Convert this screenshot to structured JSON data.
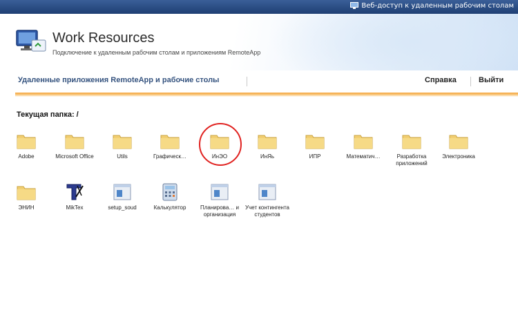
{
  "topbar": {
    "label": "Веб-доступ к удаленным рабочим столам"
  },
  "header": {
    "title": "Work Resources",
    "subtitle": "Подключение к удаленным рабочим столам и приложениям RemoteApp"
  },
  "nav": {
    "title": "Удаленные приложения RemoteApp и рабочие столы",
    "help": "Справка",
    "logout": "Выйти"
  },
  "folder_path": "Текущая папка: /",
  "items": [
    {
      "label": "Adobe",
      "icon": "folder-icon"
    },
    {
      "label": "Microsoft Office",
      "icon": "folder-icon"
    },
    {
      "label": "Utils",
      "icon": "folder-icon"
    },
    {
      "label": "Графическ…",
      "icon": "folder-icon"
    },
    {
      "label": "ИнЭО",
      "icon": "folder-icon"
    },
    {
      "label": "ИнЯь",
      "icon": "folder-icon"
    },
    {
      "label": "ИПР",
      "icon": "folder-icon"
    },
    {
      "label": "Математич…",
      "icon": "folder-icon"
    },
    {
      "label": "Разработка приложений",
      "icon": "folder-icon"
    },
    {
      "label": "Электроника",
      "icon": "folder-icon"
    },
    {
      "label": "ЭНИН",
      "icon": "folder-icon"
    },
    {
      "label": "MikTex",
      "icon": "miktex-icon"
    },
    {
      "label": "setup_soud",
      "icon": "app-window-icon"
    },
    {
      "label": "Калькулятор",
      "icon": "calculator-icon"
    },
    {
      "label": "Планирова… и организация",
      "icon": "app-window-icon"
    },
    {
      "label": "Учет контингента студентов",
      "icon": "app-window-icon"
    }
  ],
  "colors": {
    "accent_orange": "#f3a33a",
    "nav_title_blue": "#35537f",
    "highlight_red": "#e0201e"
  }
}
